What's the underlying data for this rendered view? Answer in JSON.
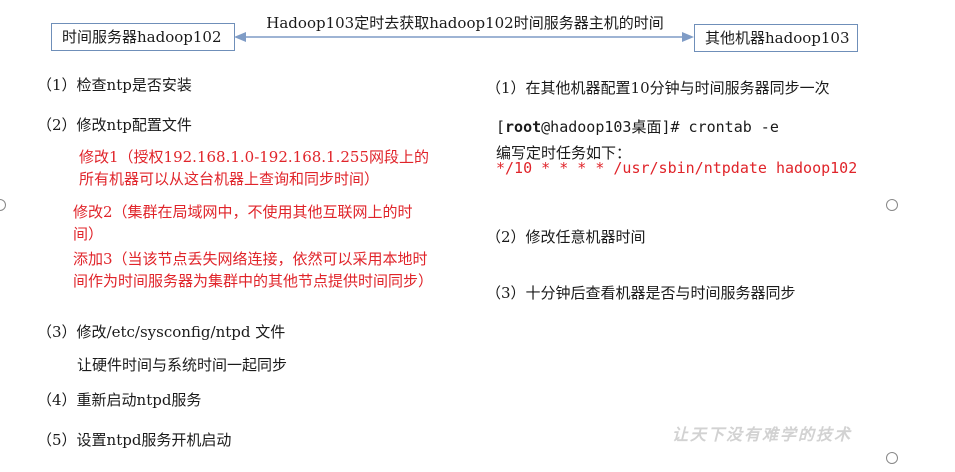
{
  "header": {
    "left_box": "时间服务器hadoop102",
    "right_box": "其他机器hadoop103",
    "arrow_label": "Hadoop103定时去获取hadoop102时间服务器主机的时间"
  },
  "left_steps": {
    "s1": "（1）检查ntp是否安装",
    "s2": "（2）修改ntp配置文件",
    "s2_red1": "修改1（授权192.168.1.0-192.168.1.255网段上的所有机器可以从这台机器上查询和同步时间）",
    "s2_red2": "修改2（集群在局域网中，不使用其他互联网上的时间）",
    "s2_red3": "添加3（当该节点丢失网络连接，依然可以采用本地时间作为时间服务器为集群中的其他节点提供时间同步）",
    "s3": "（3）修改/etc/sysconfig/ntpd 文件",
    "s3_sub": "让硬件时间与系统时间一起同步",
    "s4": "（4）重新启动ntpd服务",
    "s5": "（5）设置ntpd服务开机启动"
  },
  "right_steps": {
    "s1": "（1）在其他机器配置10分钟与时间服务器同步一次",
    "cmd_open": "[",
    "cmd_user": "root",
    "cmd_rest": "@hadoop103桌面]# crontab -e",
    "cmd_desc": "编写定时任务如下：",
    "cron_line": "*/10  *   *   *   *   /usr/sbin/ntpdate hadoop102",
    "s2": "（2）修改任意机器时间",
    "s3": "（3）十分钟后查看机器是否与时间服务器同步"
  },
  "watermark": "让天下没有难学的技术",
  "colors": {
    "red": "#e0242a",
    "box_border": "#6f8fb9",
    "arrow": "#7f9cc6"
  }
}
